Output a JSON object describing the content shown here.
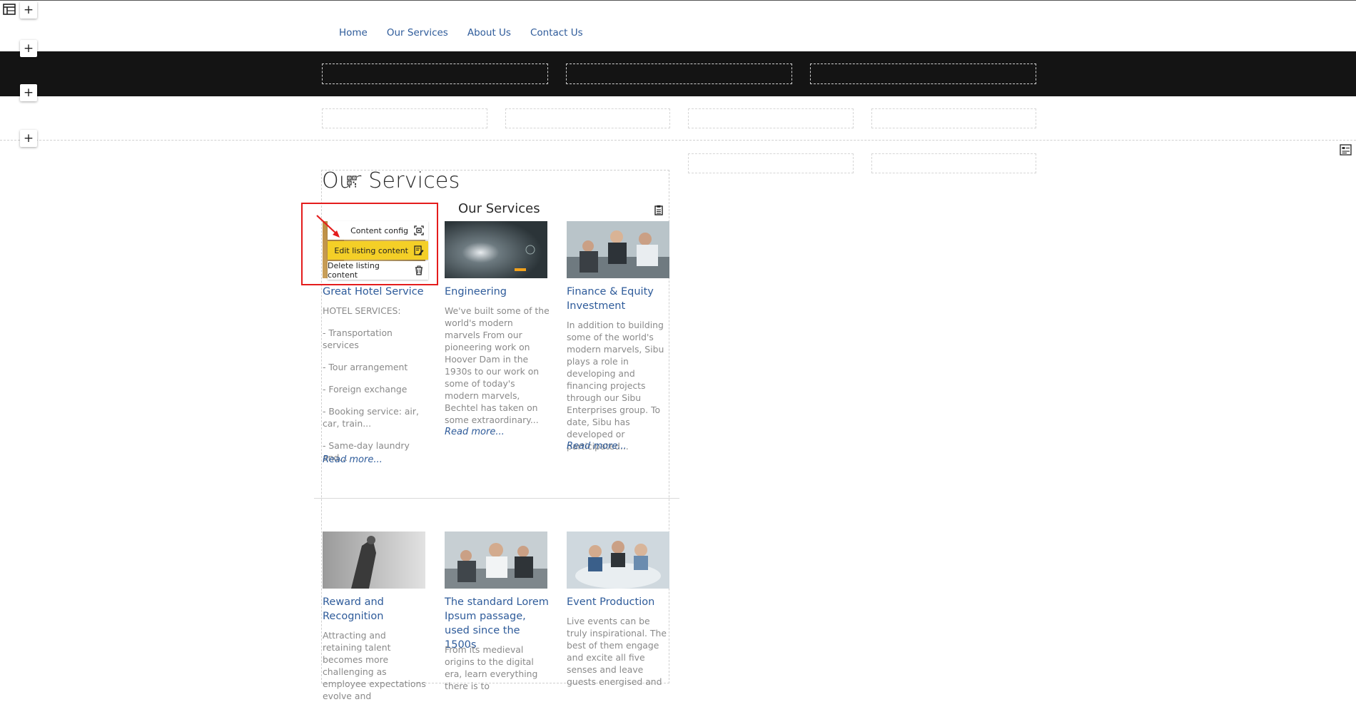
{
  "nav": {
    "items": [
      "Home",
      "Our Services",
      "About Us",
      "Contact Us"
    ]
  },
  "editor": {
    "add_label": "+"
  },
  "module": {
    "title": "Our Services",
    "subtitle": "Our Services"
  },
  "context_menu": {
    "items": [
      {
        "label": "Content config",
        "icon": "content-config-icon",
        "active": false
      },
      {
        "label": "Edit listing content",
        "icon": "edit-icon",
        "active": true
      },
      {
        "label": "Delete listing content",
        "icon": "trash-icon",
        "active": false
      }
    ],
    "highlight_color": "#f4cf27",
    "annotation_color": "#e41c1c"
  },
  "cards": [
    {
      "title": "Great Hotel Service",
      "paragraphs": [
        "HOTEL SERVICES:",
        "- Transportation services",
        "- Tour arrangement",
        "- Foreign exchange",
        "- Booking service: air, car, train...",
        "- Same-day laundry and..."
      ],
      "read_more": "Read more..."
    },
    {
      "title": "Engineering",
      "paragraphs": [
        "We've built some of the world's modern marvels From our pioneering work on Hoover Dam in the 1930s to our work on some of today's modern marvels, Bechtel has taken on some extraordinary..."
      ],
      "read_more": "Read more..."
    },
    {
      "title": "Finance & Equity Investment",
      "paragraphs": [
        "In addition to building some of the world's modern marvels, Sibu plays a role in developing and financing projects through our Sibu Enterprises group. To date, Sibu has developed or participated..."
      ],
      "read_more": "Read more..."
    },
    {
      "title": "Reward and Recognition",
      "paragraphs": [
        "Attracting and retaining talent becomes more challenging as employee expectations evolve and"
      ],
      "read_more": ""
    },
    {
      "title": "The standard Lorem Ipsum passage, used since the 1500s",
      "paragraphs": [
        "From its medieval origins to the digital era, learn everything there is to"
      ],
      "read_more": ""
    },
    {
      "title": "Event Production",
      "paragraphs": [
        "Live events can be truly inspirational. The best of them engage and excite all five senses and leave guests energised and"
      ],
      "read_more": ""
    }
  ],
  "colors": {
    "link": "#2e5b9a",
    "band": "#141414",
    "body_text": "#8a8a8a"
  }
}
